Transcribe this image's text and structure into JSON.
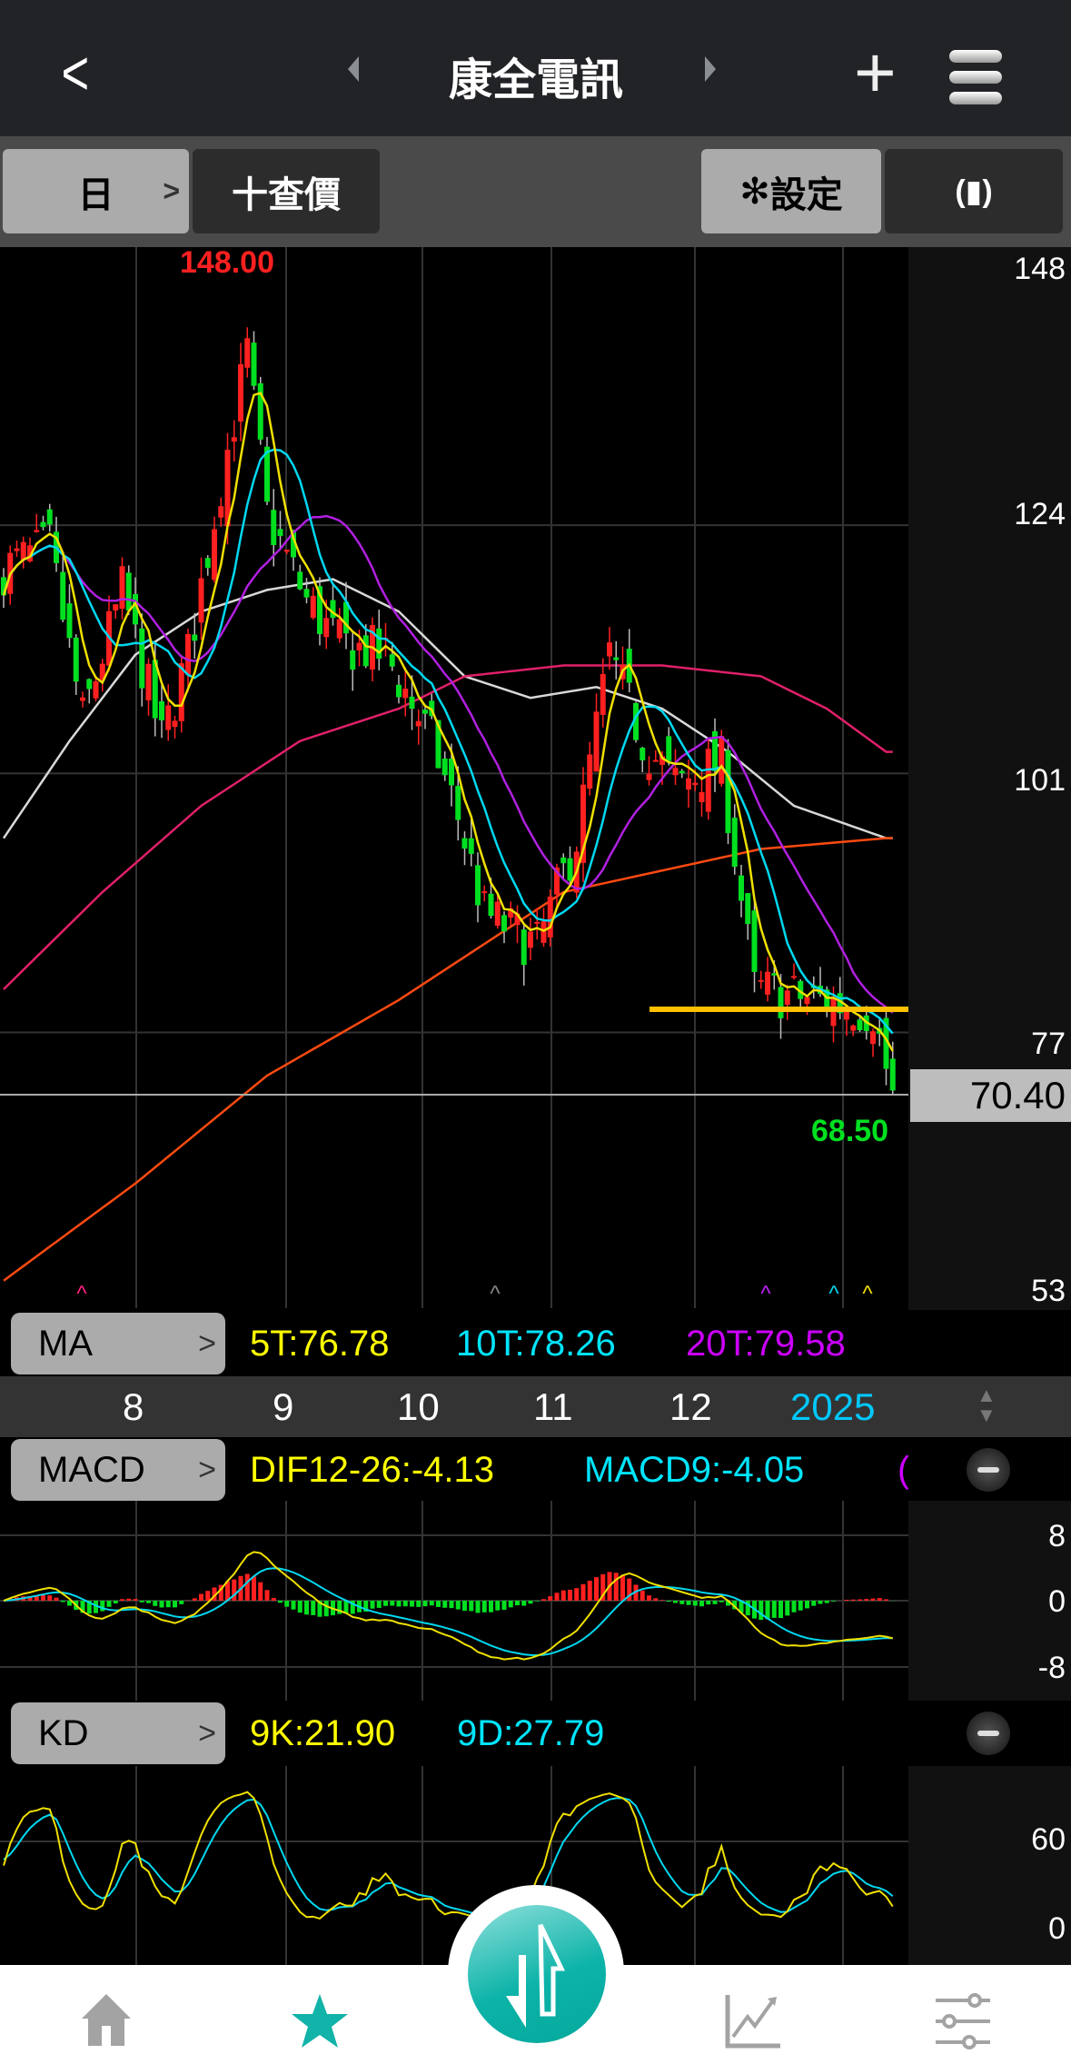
{
  "header": {
    "title": "康全電訊",
    "back_icon": "chevron-left-icon",
    "add_icon": "plus-icon",
    "menu_icon": "hamburger-icon"
  },
  "toolbar": {
    "period": "日",
    "period_chevron": ">",
    "quote": "十查價",
    "settings": "設定",
    "settings_icon": "gear-icon",
    "rotate_icon": "rotate-icon"
  },
  "price_axis": [
    "148",
    "124",
    "101",
    "77",
    "53"
  ],
  "current_price": "70.40",
  "high_label": "148.00",
  "low_label": "68.50",
  "ma": {
    "label": "MA",
    "chevron": ">",
    "items": [
      {
        "text": "5T:76.78",
        "color": "#ffff00"
      },
      {
        "text": "10T:78.26",
        "color": "#00e5ff"
      },
      {
        "text": "20T:79.58",
        "color": "#cc00ff"
      }
    ]
  },
  "dates": [
    "8",
    "9",
    "10",
    "11",
    "12",
    "2025"
  ],
  "macd": {
    "label": "MACD",
    "chevron": ">",
    "dif": "DIF12-26:-4.13",
    "macd9": "MACD9:-4.05",
    "osc": "(",
    "axis": [
      "8",
      "0",
      "-8"
    ]
  },
  "kd": {
    "label": "KD",
    "chevron": ">",
    "k": "9K:21.90",
    "d": "9D:27.79",
    "axis": [
      "60",
      "0"
    ]
  },
  "nav": [
    "home-icon",
    "favorites-star-icon",
    "trade-icon",
    "chart-trend-icon",
    "settings-sliders-icon"
  ],
  "colors": {
    "up": "#ff2020",
    "down": "#00e020",
    "support": "#ffc000",
    "teal": "#0cb3a8"
  },
  "chart_data": {
    "type": "candlestick",
    "note": "approximate close path (day index, price)",
    "close_keypoints": [
      [
        0,
        120
      ],
      [
        7,
        122
      ],
      [
        12,
        106
      ],
      [
        18,
        118
      ],
      [
        24,
        104
      ],
      [
        28,
        112
      ],
      [
        33,
        128
      ],
      [
        37,
        140
      ],
      [
        40,
        125
      ],
      [
        46,
        117
      ],
      [
        51,
        113
      ],
      [
        58,
        112
      ],
      [
        65,
        104
      ],
      [
        69,
        97
      ],
      [
        73,
        88
      ],
      [
        81,
        85
      ],
      [
        87,
        95
      ],
      [
        92,
        112
      ],
      [
        97,
        104
      ],
      [
        102,
        100
      ],
      [
        109,
        102
      ],
      [
        114,
        81
      ],
      [
        124,
        80
      ],
      [
        132,
        79
      ],
      [
        135,
        71
      ]
    ],
    "ma60_keypoints": [
      [
        0,
        95
      ],
      [
        10,
        104
      ],
      [
        20,
        112
      ],
      [
        30,
        116
      ],
      [
        40,
        118
      ],
      [
        50,
        119
      ],
      [
        60,
        116
      ],
      [
        70,
        110
      ],
      [
        80,
        108
      ],
      [
        90,
        109
      ],
      [
        100,
        107
      ],
      [
        110,
        103
      ],
      [
        120,
        98
      ],
      [
        134,
        95
      ]
    ],
    "ma120_keypoints": [
      [
        0,
        81
      ],
      [
        15,
        90
      ],
      [
        30,
        98
      ],
      [
        45,
        104
      ],
      [
        60,
        107
      ],
      [
        70,
        110
      ],
      [
        85,
        111
      ],
      [
        100,
        111
      ],
      [
        115,
        110
      ],
      [
        125,
        107
      ],
      [
        134,
        103
      ]
    ],
    "ma240_keypoints": [
      [
        0,
        54
      ],
      [
        20,
        63
      ],
      [
        40,
        73
      ],
      [
        60,
        80
      ],
      [
        75,
        86
      ],
      [
        85,
        90
      ],
      [
        100,
        92
      ],
      [
        115,
        94
      ],
      [
        134,
        95
      ]
    ]
  }
}
